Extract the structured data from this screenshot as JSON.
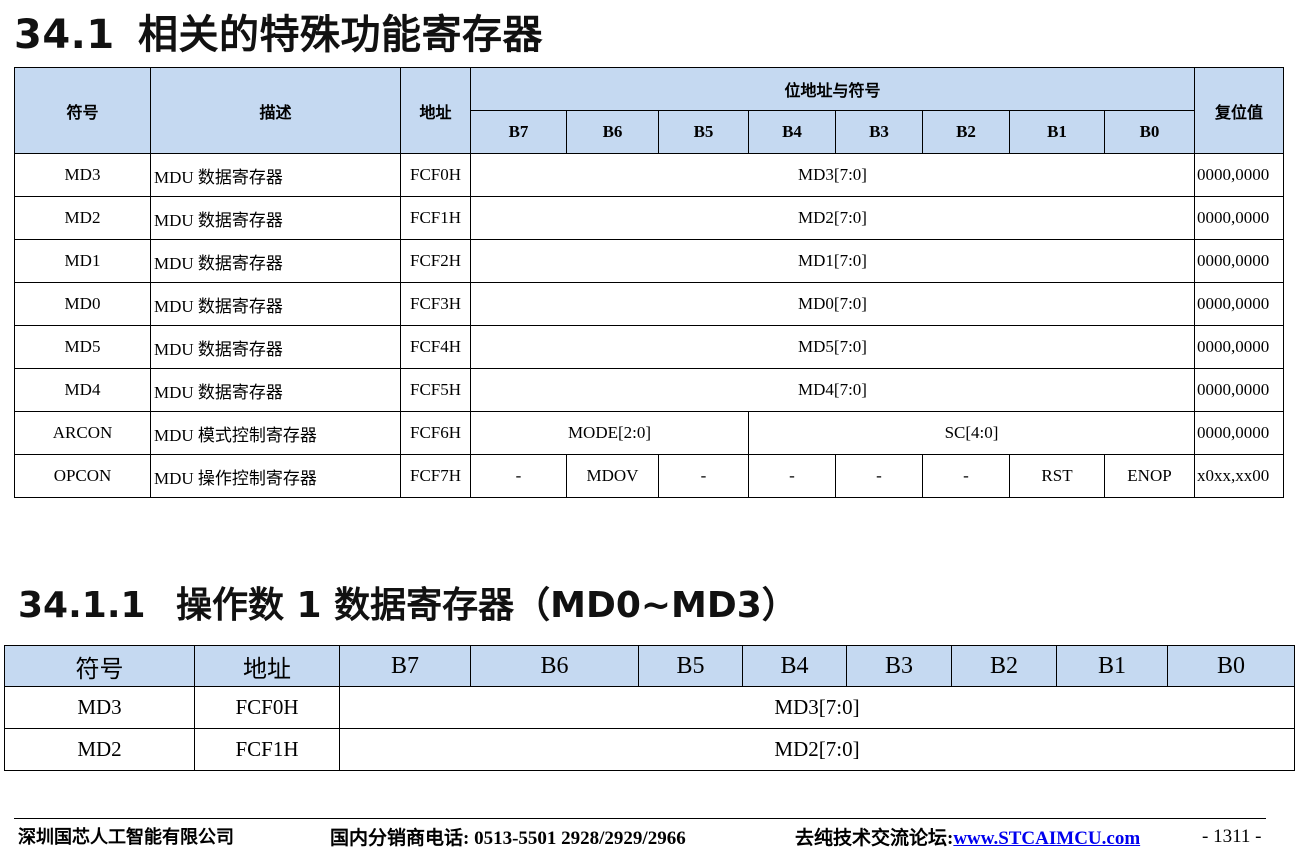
{
  "section": {
    "number": "34.1",
    "title": "相关的特殊功能寄存器"
  },
  "main_table": {
    "headers": {
      "symbol": "符号",
      "description": "描述",
      "address": "地址",
      "bit_group": "位地址与符号",
      "reset": "复位值"
    },
    "bits": [
      "B7",
      "B6",
      "B5",
      "B4",
      "B3",
      "B2",
      "B1",
      "B0"
    ],
    "rows": [
      {
        "symbol": "MD3",
        "description": "MDU 数据寄存器",
        "address": "FCF0H",
        "field": "MD3[7:0]",
        "reset": "0000,0000"
      },
      {
        "symbol": "MD2",
        "description": "MDU 数据寄存器",
        "address": "FCF1H",
        "field": "MD2[7:0]",
        "reset": "0000,0000"
      },
      {
        "symbol": "MD1",
        "description": "MDU 数据寄存器",
        "address": "FCF2H",
        "field": "MD1[7:0]",
        "reset": "0000,0000"
      },
      {
        "symbol": "MD0",
        "description": "MDU 数据寄存器",
        "address": "FCF3H",
        "field": "MD0[7:0]",
        "reset": "0000,0000"
      },
      {
        "symbol": "MD5",
        "description": "MDU 数据寄存器",
        "address": "FCF4H",
        "field": "MD5[7:0]",
        "reset": "0000,0000"
      },
      {
        "symbol": "MD4",
        "description": "MDU 数据寄存器",
        "address": "FCF5H",
        "field": "MD4[7:0]",
        "reset": "0000,0000"
      }
    ],
    "arcon": {
      "symbol": "ARCON",
      "description": "MDU 模式控制寄存器",
      "address": "FCF6H",
      "mode": "MODE[2:0]",
      "sc": "SC[4:0]",
      "reset": "0000,0000"
    },
    "opcon": {
      "symbol": "OPCON",
      "description": "MDU 操作控制寄存器",
      "address": "FCF7H",
      "bits": [
        "-",
        "MDOV",
        "-",
        "-",
        "-",
        "-",
        "RST",
        "ENOP"
      ],
      "reset": "x0xx,xx00"
    }
  },
  "subsection": {
    "number": "34.1.1",
    "title": "操作数 1 数据寄存器（MD0~MD3）"
  },
  "sub_table": {
    "headers": {
      "symbol": "符号",
      "address": "地址"
    },
    "bits": [
      "B7",
      "B6",
      "B5",
      "B4",
      "B3",
      "B2",
      "B1",
      "B0"
    ],
    "rows": [
      {
        "symbol": "MD3",
        "address": "FCF0H",
        "field": "MD3[7:0]"
      },
      {
        "symbol": "MD2",
        "address": "FCF1H",
        "field": "MD2[7:0]"
      }
    ]
  },
  "footer": {
    "company": "深圳国芯人工智能有限公司",
    "phone": "国内分销商电话: 0513-5501 2928/2929/2966",
    "forum_label": "去纯技术交流论坛:",
    "forum_link": "www.STCAIMCU.com",
    "page": "- 1311 -"
  }
}
